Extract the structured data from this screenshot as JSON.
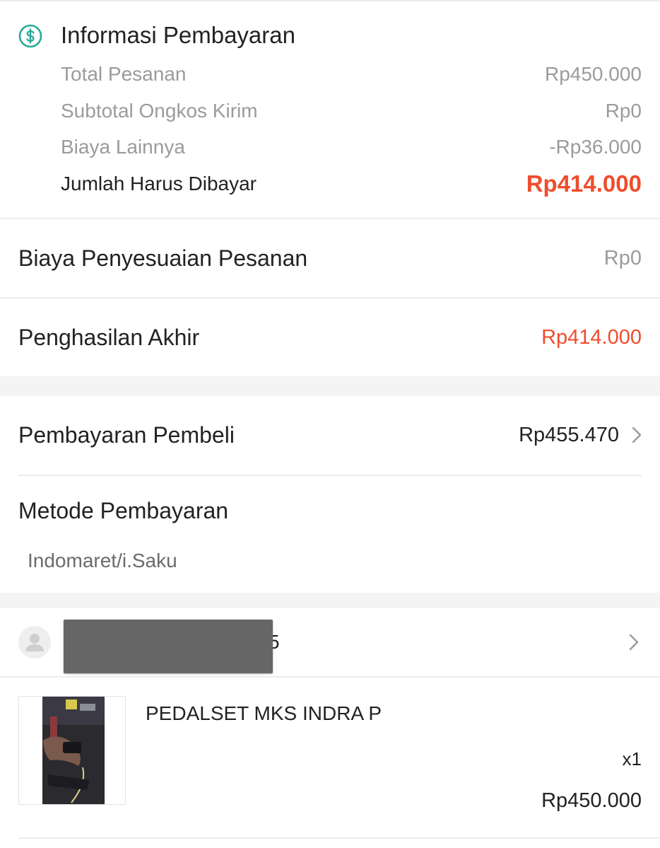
{
  "payment_info": {
    "title": "Informasi Pembayaran",
    "icon": "dollar-circle-icon",
    "rows": [
      {
        "label": "Total Pesanan",
        "amount": "Rp450.000"
      },
      {
        "label": "Subtotal Ongkos Kirim",
        "amount": "Rp0"
      },
      {
        "label": "Biaya Lainnya",
        "amount": "-Rp36.000"
      }
    ],
    "total": {
      "label": "Jumlah Harus Dibayar",
      "amount": "Rp414.000"
    }
  },
  "adjustment": {
    "label": "Biaya Penyesuaian Pesanan",
    "amount": "Rp0"
  },
  "final_income": {
    "label": "Penghasilan Akhir",
    "amount": "Rp414.000"
  },
  "buyer_payment": {
    "label": "Pembayaran Pembeli",
    "amount": "Rp455.470"
  },
  "payment_method": {
    "label": "Metode Pembayaran",
    "value": "Indomaret/i.Saku"
  },
  "buyer": {
    "name_peek": "5"
  },
  "product": {
    "name": "PEDALSET MKS INDRA P",
    "quantity": "x1",
    "price": "Rp450.000"
  },
  "colors": {
    "accent": "#ee4d2d",
    "icon_teal": "#26aa99",
    "muted": "#9b9b9b"
  }
}
